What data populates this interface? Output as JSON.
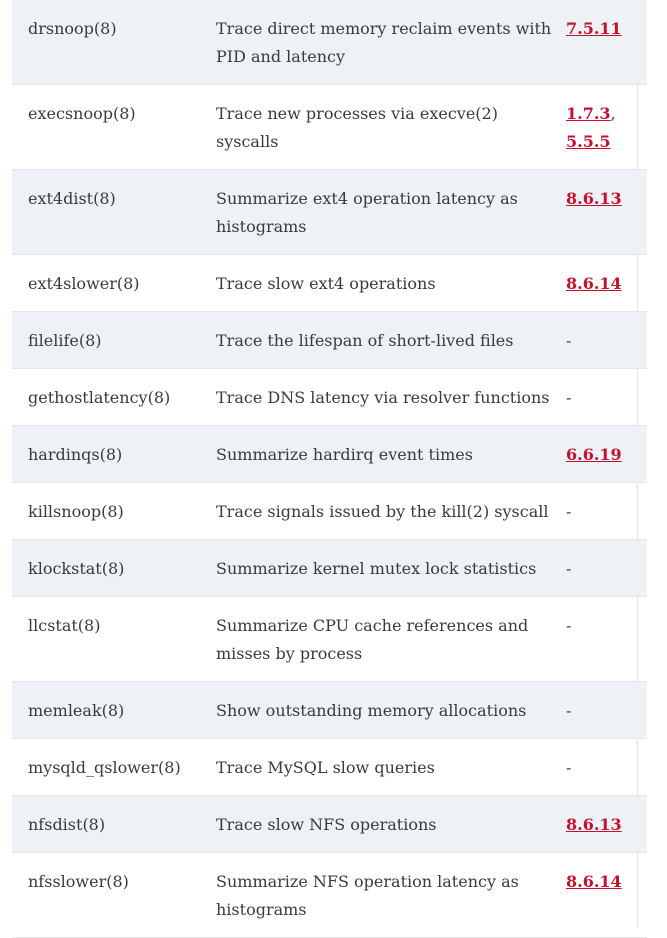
{
  "rows": [
    {
      "name": "drsnoop(8)",
      "desc": "Trace direct memory reclaim events with PID and latency",
      "refs": [
        "7.5.11"
      ],
      "shaded": true
    },
    {
      "name": "execsnoop(8)",
      "desc": "Trace new processes via execve(2) syscalls",
      "refs": [
        "1.7.3",
        "5.5.5"
      ],
      "shaded": false
    },
    {
      "name": "ext4dist(8)",
      "desc": "Summarize ext4 operation latency as histograms",
      "refs": [
        "8.6.13"
      ],
      "shaded": true
    },
    {
      "name": "ext4slower(8)",
      "desc": "Trace slow ext4 operations",
      "refs": [
        "8.6.14"
      ],
      "shaded": false
    },
    {
      "name": "filelife(8)",
      "desc": "Trace the lifespan of short-lived files",
      "refs": [],
      "shaded": true
    },
    {
      "name": "gethostlatency(8)",
      "desc": "Trace DNS latency via resolver functions",
      "refs": [],
      "shaded": false
    },
    {
      "name": "hardinqs(8)",
      "desc": "Summarize hardirq event times",
      "refs": [
        "6.6.19"
      ],
      "shaded": true
    },
    {
      "name": "killsnoop(8)",
      "desc": "Trace signals issued by the kill(2) syscall",
      "refs": [],
      "shaded": false
    },
    {
      "name": "klockstat(8)",
      "desc": "Summarize kernel mutex lock statistics",
      "refs": [],
      "shaded": true
    },
    {
      "name": "llcstat(8)",
      "desc": "Summarize CPU cache references and misses by process",
      "refs": [],
      "shaded": false
    },
    {
      "name": "memleak(8)",
      "desc": "Show outstanding memory allocations",
      "refs": [],
      "shaded": true
    },
    {
      "name": "mysqld_qslower(8)",
      "desc": "Trace MySQL slow queries",
      "refs": [],
      "shaded": false
    },
    {
      "name": "nfsdist(8)",
      "desc": "Trace slow NFS operations",
      "refs": [
        "8.6.13"
      ],
      "shaded": true
    },
    {
      "name": "nfsslower(8)",
      "desc": "Summarize NFS operation latency as histograms",
      "refs": [
        "8.6.14"
      ],
      "shaded": false
    }
  ],
  "empty_ref": "-",
  "ref_separator": ", ",
  "colors": {
    "link": "#c8102e",
    "shaded_row": "#eef1f5",
    "text": "#3a3a3a"
  }
}
